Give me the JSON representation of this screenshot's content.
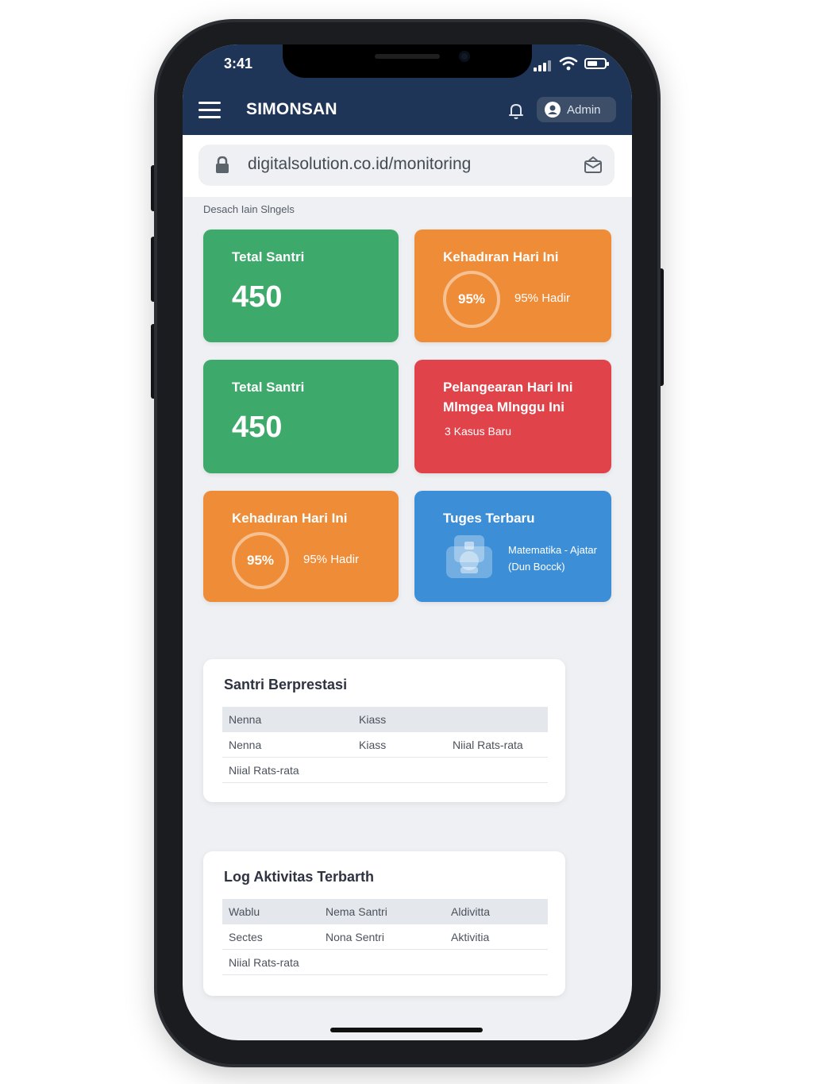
{
  "status_bar": {
    "time": "3:41"
  },
  "app": {
    "title": "SIMONSAN",
    "user_label": "Admin"
  },
  "browser": {
    "url": "digitalsolution.co.id/monitoring"
  },
  "dashboard": {
    "caption": "Desach Iain Slngels",
    "cards": [
      {
        "title": "Tetal Santri",
        "value": "450",
        "color": "#3daa6b"
      },
      {
        "title": "Kehadıran Hari Ini",
        "ring_value": "95%",
        "caption": "95% Hadir",
        "color": "#ef8c37"
      },
      {
        "title": "Tetal Santri",
        "value": "450",
        "color": "#3daa6b"
      },
      {
        "title_line1": "Pelangearan Hari Ini",
        "title_line2": "Mlmgea Mlnggu Ini",
        "sub": "3 Kasus Baru",
        "color": "#e0444a"
      },
      {
        "title": "Kehadıran Hari Ini",
        "ring_value": "95%",
        "caption": "95% Hadir",
        "color": "#ef8c37"
      },
      {
        "title": "Tuges Terbaru",
        "desc_line1": "Matematika - Ajatar",
        "desc_line2": "(Dun Bocck)",
        "icon": "book-icon",
        "color": "#3c8fd6"
      }
    ]
  },
  "achievers": {
    "title": "Santri Berprestasi",
    "header": [
      "Nenna",
      "Kiass"
    ],
    "rows": [
      [
        "Nenna",
        "Kiass",
        "Niial Rats-rata"
      ],
      [
        "Niial Rats-rata",
        "",
        ""
      ]
    ]
  },
  "activity_log": {
    "title": "Log Aktivitas Terbarth",
    "header": [
      "Wablu",
      "Nema Santri",
      "Aldivitta"
    ],
    "rows": [
      [
        "Sectes",
        "Nona Sentri",
        "Aktivitia"
      ],
      [
        "Niial Rats-rata",
        "",
        ""
      ]
    ]
  },
  "colors": {
    "header": "#1e3557",
    "background": "#eef0f3"
  }
}
